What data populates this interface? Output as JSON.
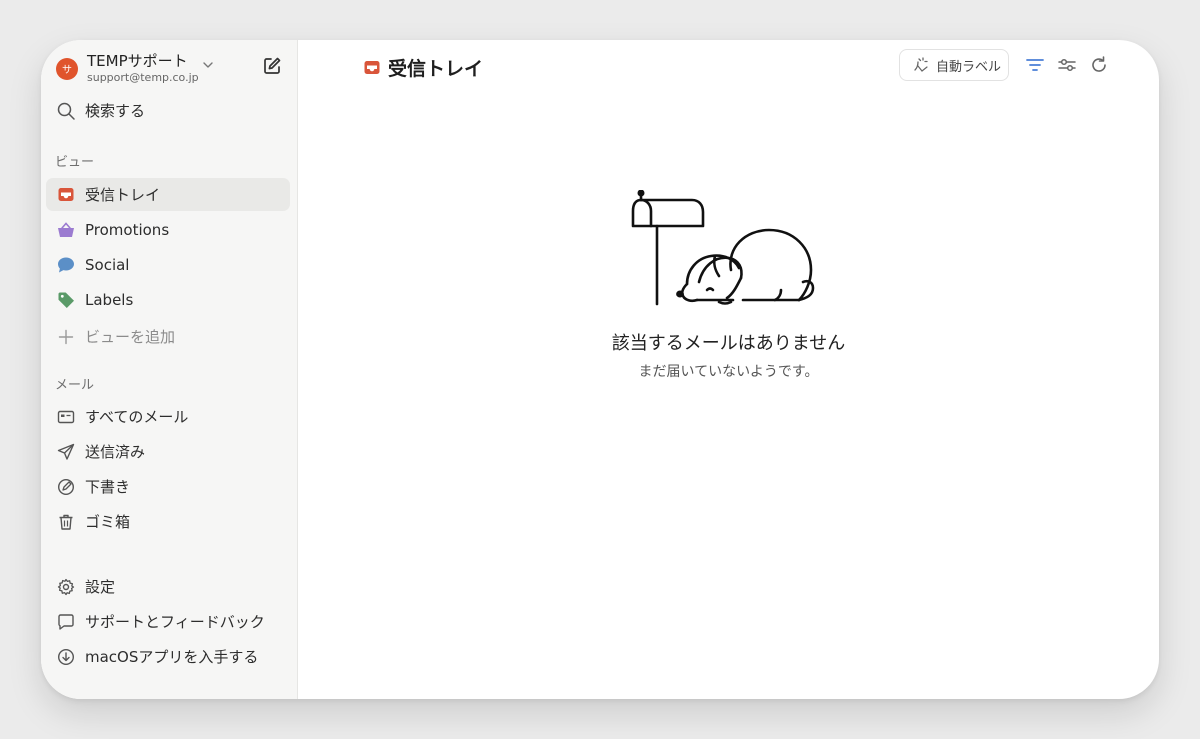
{
  "account": {
    "avatar_initial": "サ",
    "name": "TEMPサポート",
    "email": "support@temp.co.jp"
  },
  "search": {
    "label": "検索する"
  },
  "views": {
    "section_label": "ビュー",
    "items": [
      {
        "label": "受信トレイ",
        "icon": "inbox-icon",
        "color": "#d9553a"
      },
      {
        "label": "Promotions",
        "icon": "basket-icon",
        "color": "#9b7bd0"
      },
      {
        "label": "Social",
        "icon": "chat-bubble-icon",
        "color": "#5b8fc7"
      },
      {
        "label": "Labels",
        "icon": "tag-icon",
        "color": "#5a9a68"
      }
    ],
    "add_label": "ビューを追加"
  },
  "mail": {
    "section_label": "メール",
    "items": [
      {
        "label": "すべてのメール",
        "icon": "all-mail-icon"
      },
      {
        "label": "送信済み",
        "icon": "send-icon"
      },
      {
        "label": "下書き",
        "icon": "draft-icon"
      },
      {
        "label": "ゴミ箱",
        "icon": "trash-icon"
      }
    ]
  },
  "footer": {
    "items": [
      {
        "label": "設定",
        "icon": "gear-icon"
      },
      {
        "label": "サポートとフィードバック",
        "icon": "feedback-icon"
      },
      {
        "label": "macOSアプリを入手する",
        "icon": "download-icon"
      }
    ]
  },
  "header": {
    "title": "受信トレイ",
    "auto_label": "自動ラベル",
    "accent_color": "#4a7fd6"
  },
  "empty_state": {
    "title": "該当するメールはありません",
    "subtitle": "まだ届いていないようです。"
  }
}
